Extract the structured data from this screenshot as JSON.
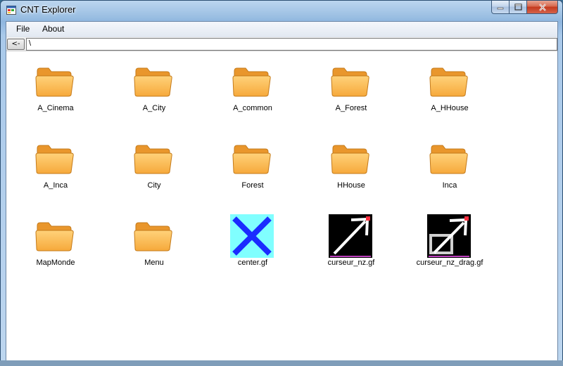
{
  "window": {
    "title": "CNT Explorer"
  },
  "menubar": {
    "file_label": "File",
    "about_label": "About"
  },
  "pathbar": {
    "back_label": "<-",
    "path_value": "\\"
  },
  "items": [
    {
      "label": "A_Cinema",
      "type": "folder"
    },
    {
      "label": "A_City",
      "type": "folder"
    },
    {
      "label": "A_common",
      "type": "folder"
    },
    {
      "label": "A_Forest",
      "type": "folder"
    },
    {
      "label": "A_HHouse",
      "type": "folder"
    },
    {
      "label": "A_Inca",
      "type": "folder"
    },
    {
      "label": "City",
      "type": "folder"
    },
    {
      "label": "Forest",
      "type": "folder"
    },
    {
      "label": "HHouse",
      "type": "folder"
    },
    {
      "label": "Inca",
      "type": "folder"
    },
    {
      "label": "MapMonde",
      "type": "folder"
    },
    {
      "label": "Menu",
      "type": "folder"
    },
    {
      "label": "center.gf",
      "type": "image-center"
    },
    {
      "label": "curseur_nz.gf",
      "type": "image-cursor"
    },
    {
      "label": "curseur_nz_drag.gf",
      "type": "image-cursor-drag"
    }
  ],
  "colors": {
    "folder_body": "#f6a93b",
    "folder_back": "#e9962c",
    "center_bg": "#80ffff",
    "center_x": "#1a2cff",
    "cursor_bg": "#000000",
    "cursor_arrow": "#ffffff"
  }
}
